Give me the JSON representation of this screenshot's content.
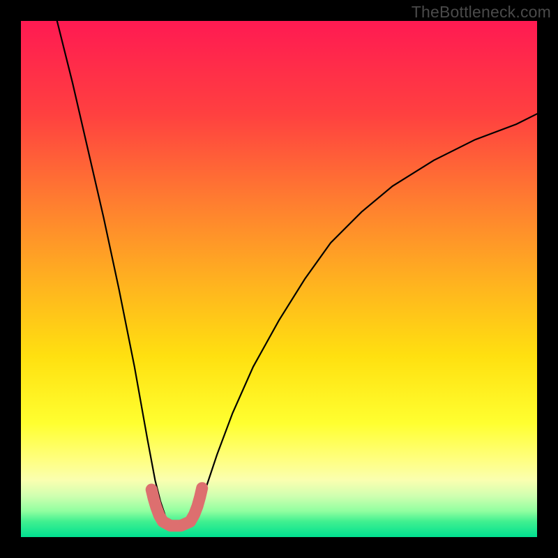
{
  "attribution": "TheBottleneck.com",
  "chart_data": {
    "type": "line",
    "title": "",
    "xlabel": "",
    "ylabel": "",
    "x_range": [
      0,
      100
    ],
    "y_range": [
      0,
      100
    ],
    "background": "gradient (red top → green bottom)",
    "series": [
      {
        "name": "v-curve",
        "color": "#000000",
        "x": [
          7,
          10,
          13,
          16,
          19,
          22,
          24.5,
          26,
          27,
          28,
          29,
          30,
          31,
          32,
          33,
          34,
          36,
          38,
          41,
          45,
          50,
          55,
          60,
          66,
          72,
          80,
          88,
          96,
          100
        ],
        "y": [
          100,
          88,
          75,
          62,
          48,
          33,
          19,
          11,
          7,
          4,
          2.5,
          2,
          2,
          2.5,
          4,
          6,
          10,
          16,
          24,
          33,
          42,
          50,
          57,
          63,
          68,
          73,
          77,
          80,
          82
        ]
      },
      {
        "name": "trough-marker",
        "color": "#e07070",
        "type": "thick-segment",
        "x": [
          25.3,
          25.7,
          26.2,
          26.8,
          27.5,
          29.0,
          31.0,
          32.8,
          33.6,
          34.2,
          34.7,
          35.1
        ],
        "y": [
          9.2,
          7.5,
          5.8,
          4.2,
          3.0,
          2.2,
          2.2,
          3.0,
          4.4,
          6.0,
          7.8,
          9.5
        ]
      }
    ]
  }
}
